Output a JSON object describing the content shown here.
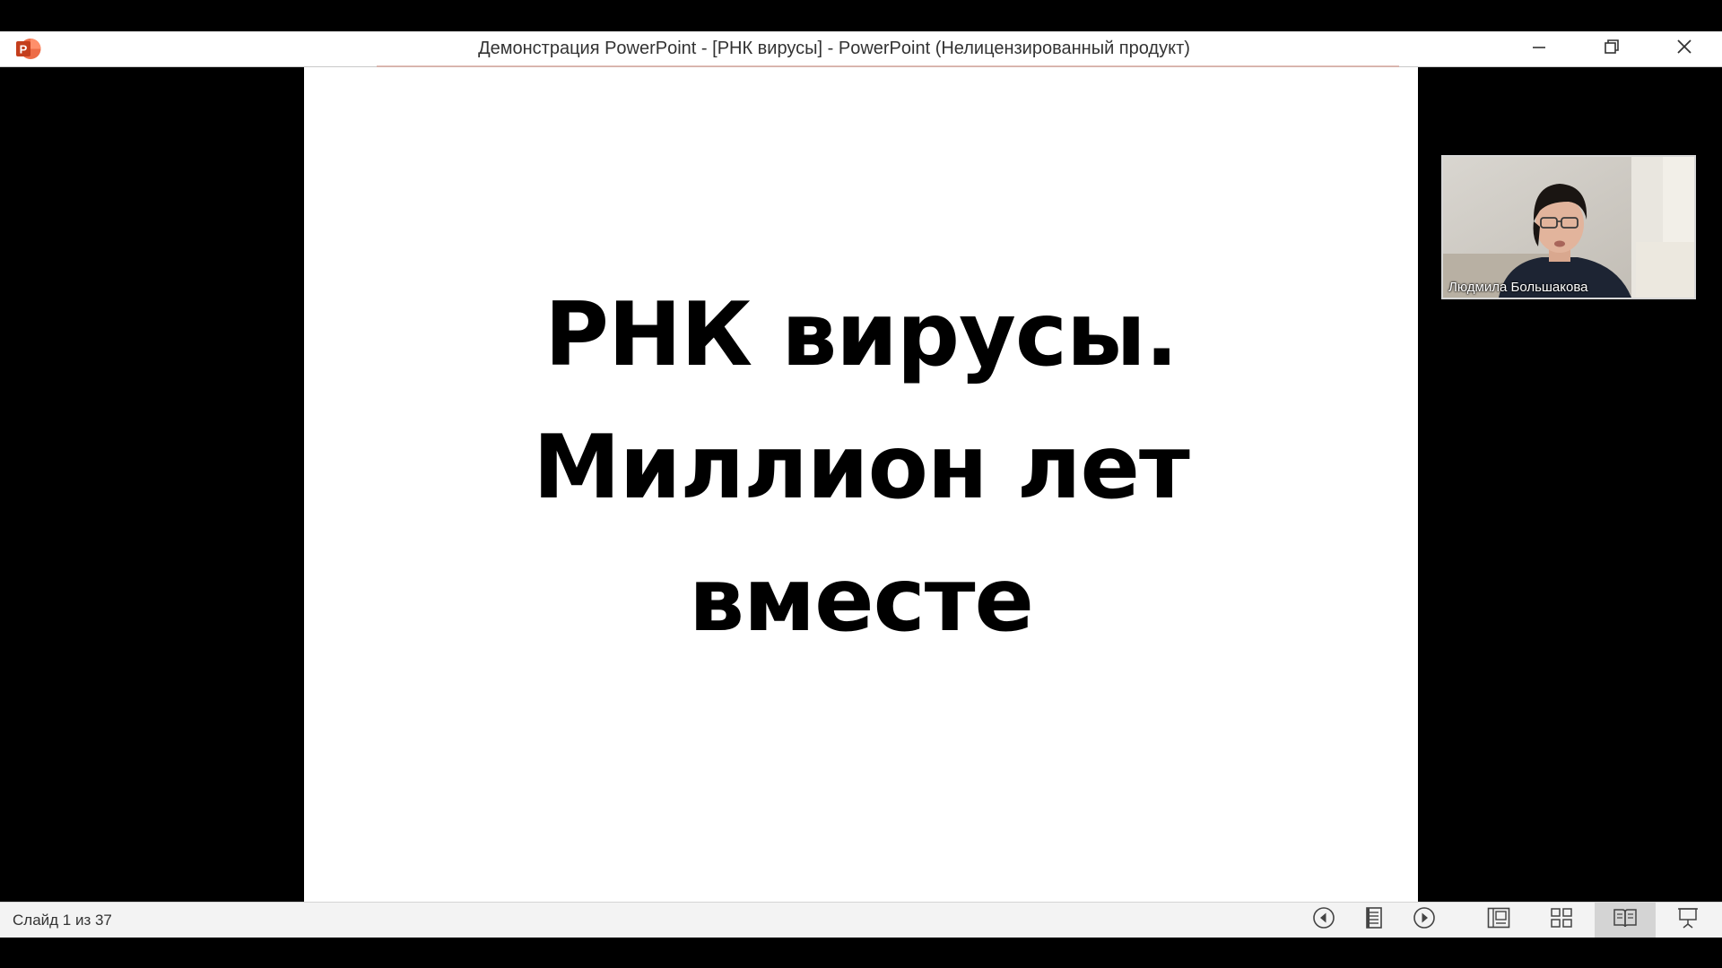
{
  "window": {
    "title": "Демонстрация PowerPoint - [РНК вирусы] - PowerPoint (Нелицензированный продукт)",
    "app_icon": "powerpoint-icon",
    "brand_color": "#d24726"
  },
  "slide": {
    "title_lines": [
      "РНК вирусы.",
      "Миллион лет",
      "вместе"
    ]
  },
  "participant": {
    "name": "Людмила Большакова"
  },
  "statusbar": {
    "slide_counter": "Слайд 1 из 37",
    "buttons": [
      {
        "name": "previous-slide",
        "icon": "circle-arrow-left-icon"
      },
      {
        "name": "slide-menu",
        "icon": "slides-list-icon"
      },
      {
        "name": "next-slide",
        "icon": "circle-arrow-right-icon"
      },
      {
        "name": "normal-view",
        "icon": "normal-view-icon"
      },
      {
        "name": "slide-sorter",
        "icon": "grid-icon"
      },
      {
        "name": "reading-view",
        "icon": "book-icon",
        "active": true
      },
      {
        "name": "slide-show",
        "icon": "presentation-icon"
      }
    ]
  }
}
